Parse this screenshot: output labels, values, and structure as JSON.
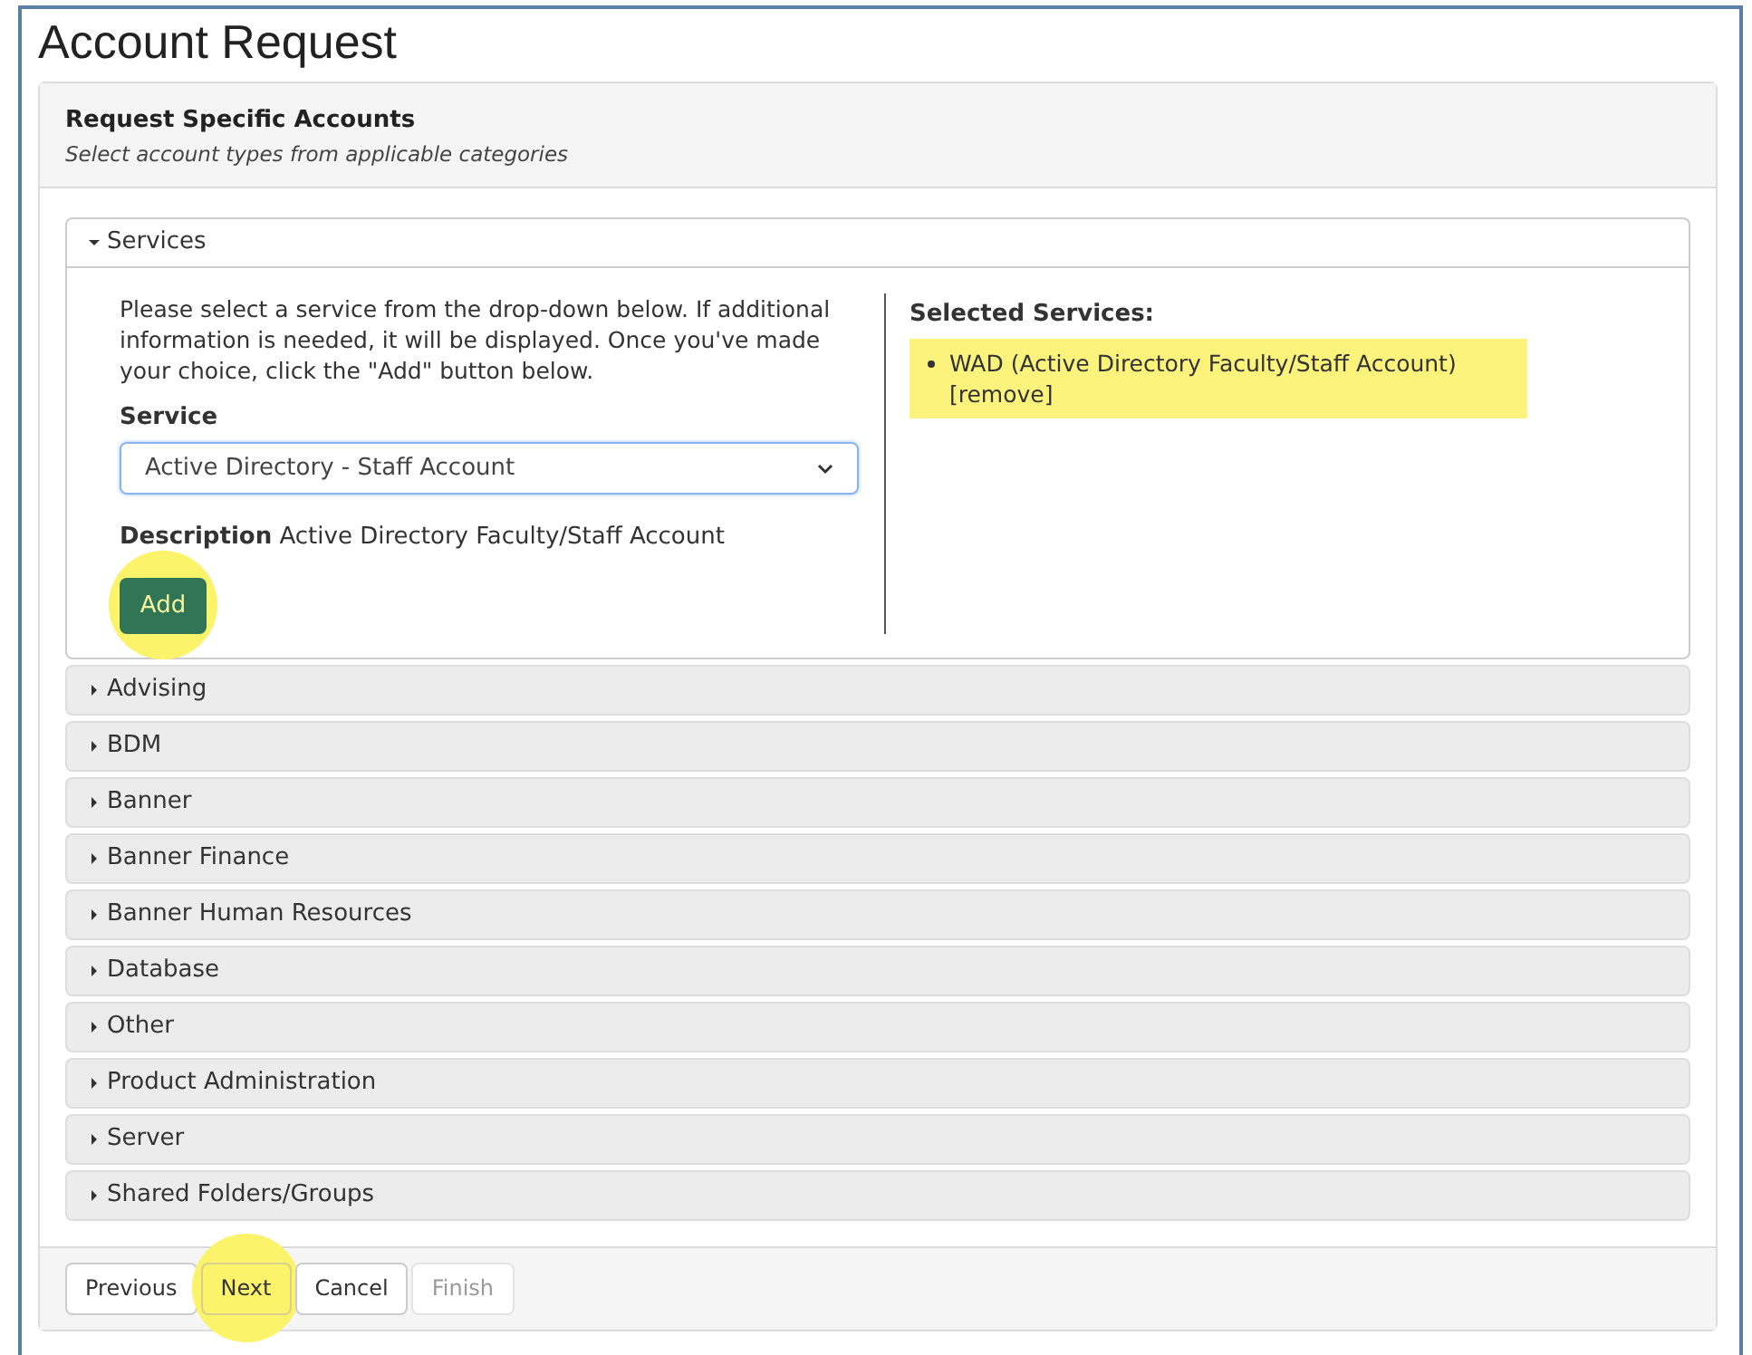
{
  "page": {
    "title": "Account Request"
  },
  "panel": {
    "title": "Request Specific Accounts",
    "subtitle": "Select account types from applicable categories"
  },
  "categories": [
    {
      "label": "Services",
      "expanded": true
    },
    {
      "label": "Advising",
      "expanded": false
    },
    {
      "label": "BDM",
      "expanded": false
    },
    {
      "label": "Banner",
      "expanded": false
    },
    {
      "label": "Banner Finance",
      "expanded": false
    },
    {
      "label": "Banner Human Resources",
      "expanded": false
    },
    {
      "label": "Database",
      "expanded": false
    },
    {
      "label": "Other",
      "expanded": false
    },
    {
      "label": "Product Administration",
      "expanded": false
    },
    {
      "label": "Server",
      "expanded": false
    },
    {
      "label": "Shared Folders/Groups",
      "expanded": false
    }
  ],
  "services": {
    "instructions": "Please select a service from the drop-down below. If additional information is needed, it will be displayed. Once you've made your choice, click the \"Add\" button below.",
    "service_label": "Service",
    "service_value": "Active Directory - Staff Account",
    "description_label": "Description",
    "description": "Active Directory Faculty/Staff Account",
    "add_button": {
      "label": "Add",
      "highlighted": true
    },
    "selected_title": "Selected Services:",
    "selected": [
      {
        "name": "WAD (Active Directory Faculty/Staff Account)",
        "remove": "[remove]",
        "highlighted": true
      }
    ]
  },
  "buttons": [
    {
      "label": "Previous",
      "disabled": false,
      "highlighted": false
    },
    {
      "label": "Next",
      "disabled": false,
      "highlighted": true
    },
    {
      "label": "Cancel",
      "disabled": false,
      "highlighted": false
    },
    {
      "label": "Finish",
      "disabled": true,
      "highlighted": false
    }
  ]
}
